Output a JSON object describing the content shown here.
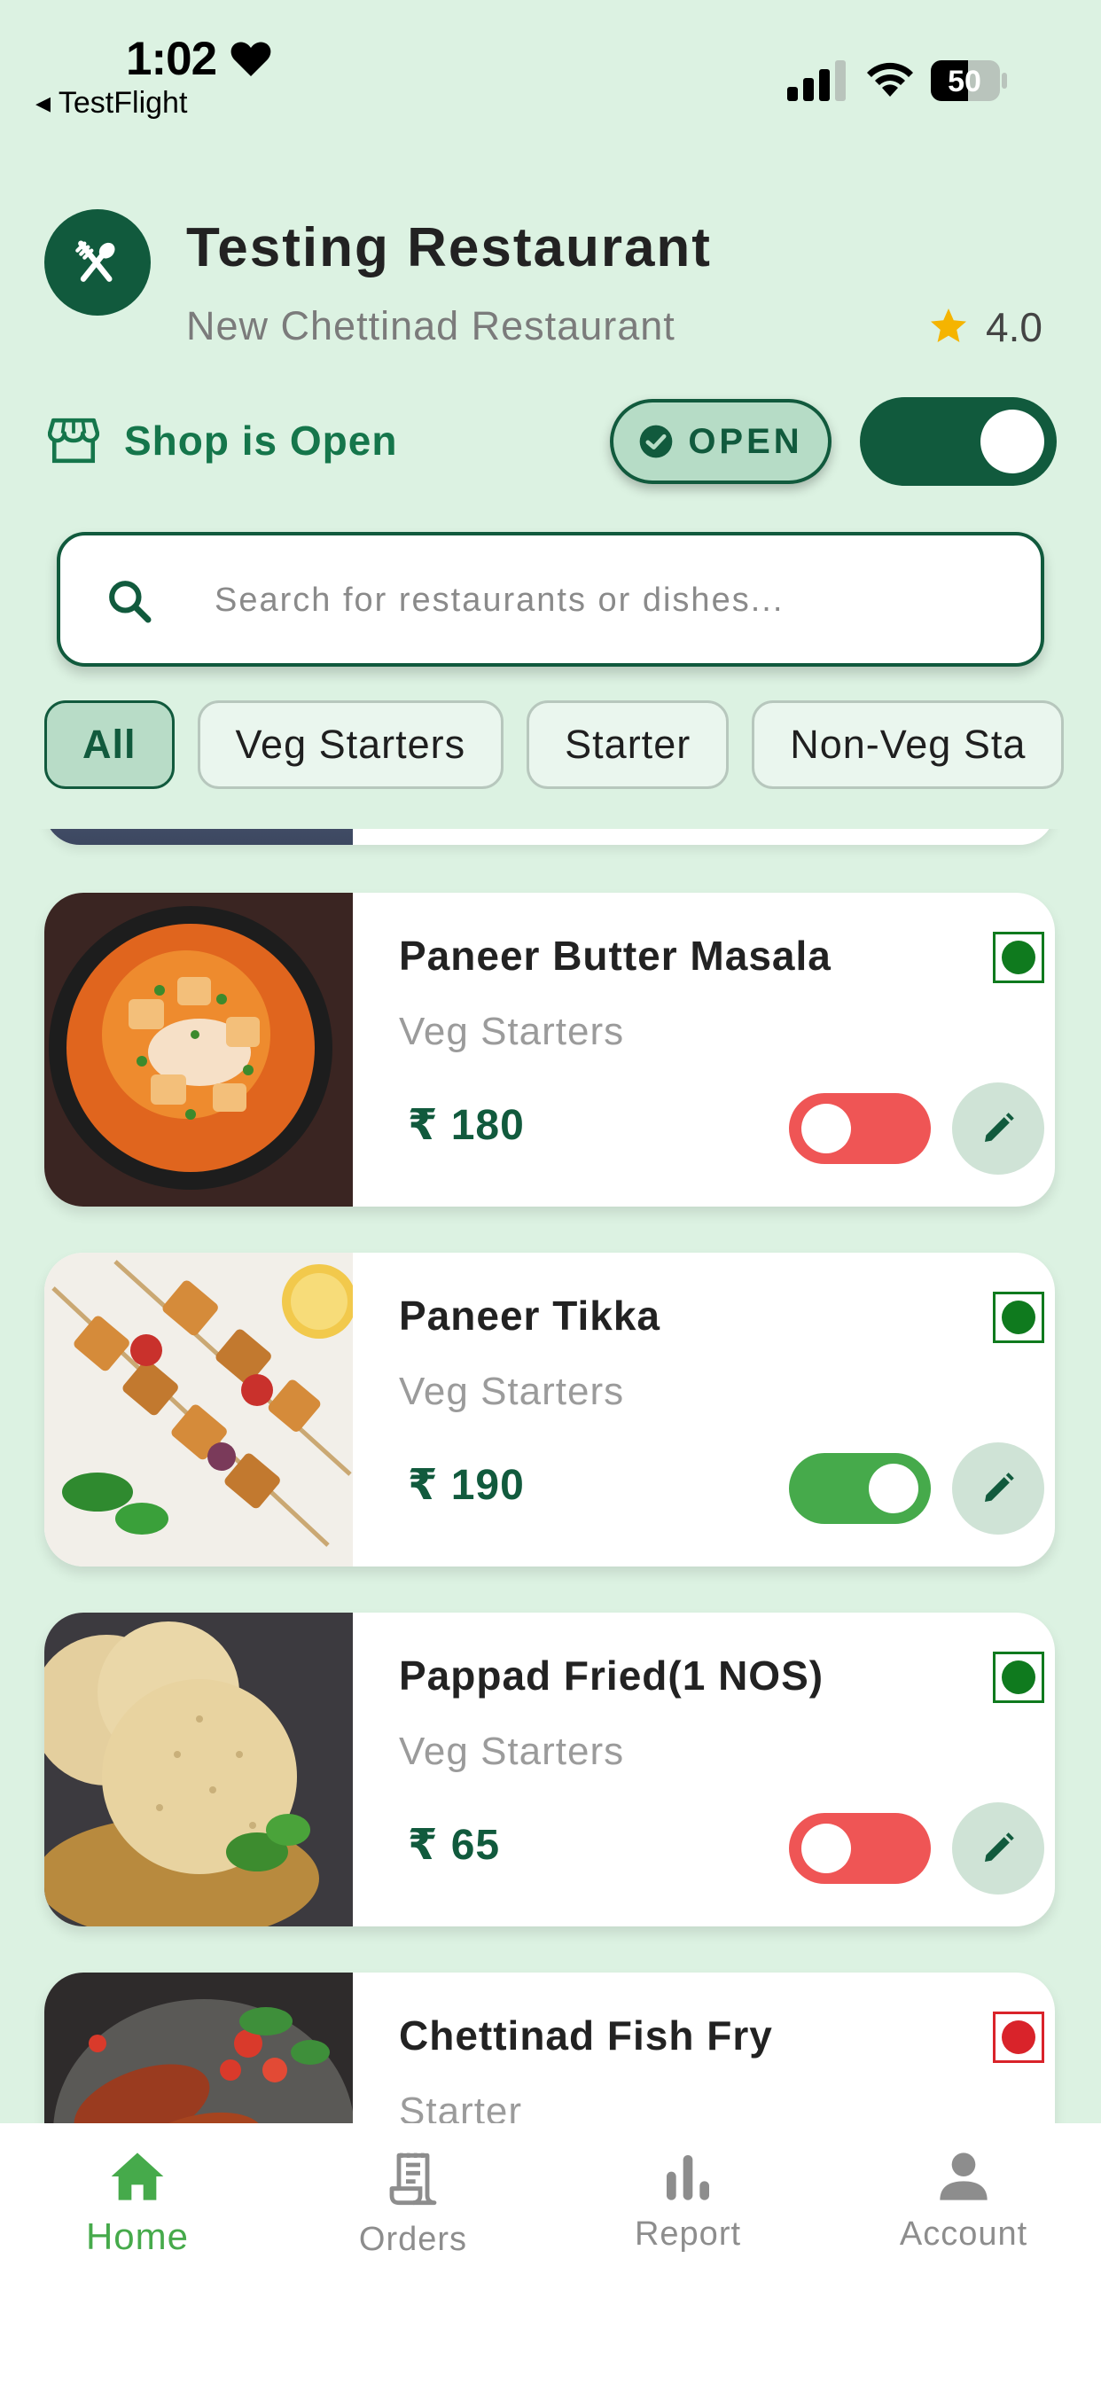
{
  "status_bar": {
    "time": "1:02",
    "back_app": "◂ TestFlight",
    "battery": "50"
  },
  "header": {
    "title": "Testing Restaurant",
    "subtitle": "New Chettinad Restaurant",
    "rating": "4.0"
  },
  "shop": {
    "label": "Shop is Open",
    "badge": "OPEN",
    "toggle_on": true
  },
  "search": {
    "placeholder": "Search for restaurants or dishes..."
  },
  "categories": [
    "All",
    "Veg Starters",
    "Starter",
    "Non-Veg Sta"
  ],
  "items": [
    {
      "name": "Paneer Butter Masala",
      "category": "Veg Starters",
      "price": "₹ 180",
      "type": "veg",
      "available": false
    },
    {
      "name": "Paneer Tikka",
      "category": "Veg Starters",
      "price": "₹ 190",
      "type": "veg",
      "available": true
    },
    {
      "name": "Pappad Fried(1 NOS)",
      "category": "Veg Starters",
      "price": "₹ 65",
      "type": "veg",
      "available": false
    },
    {
      "name": "Chettinad Fish Fry",
      "category": "Starter",
      "price": "",
      "type": "non-veg",
      "available": false
    }
  ],
  "tabs": [
    {
      "label": "Home",
      "icon": "home-icon",
      "active": true
    },
    {
      "label": "Orders",
      "icon": "receipt-icon",
      "active": false
    },
    {
      "label": "Report",
      "icon": "bar-chart-icon",
      "active": false
    },
    {
      "label": "Account",
      "icon": "person-icon",
      "active": false
    }
  ],
  "colors": {
    "primary": "#115a3d",
    "background": "#dcf2e2",
    "on": "#46aa4b",
    "off": "#ef5555",
    "veg": "#0f7a1e",
    "nonveg": "#d9232a"
  }
}
